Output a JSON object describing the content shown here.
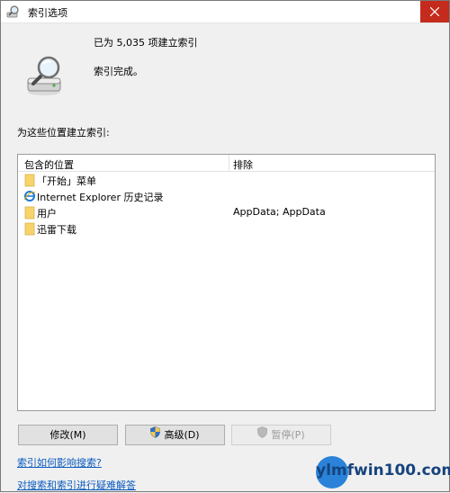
{
  "window": {
    "title": "索引选项"
  },
  "status": {
    "indexed_count": "已为 5,035 项建立索引",
    "state": "索引完成。"
  },
  "locations": {
    "heading": "为这些位置建立索引:",
    "columns": {
      "included": "包含的位置",
      "exclude": "排除"
    },
    "rows": [
      {
        "name": "「开始」菜单",
        "exclude": "",
        "icon": "folder-icon"
      },
      {
        "name": "Internet Explorer 历史记录",
        "exclude": "",
        "icon": "ie-icon"
      },
      {
        "name": "用户",
        "exclude": "AppData; AppData",
        "icon": "folder-icon"
      },
      {
        "name": "迅雷下载",
        "exclude": "",
        "icon": "folder-icon"
      }
    ]
  },
  "buttons": {
    "modify": "修改(M)",
    "advanced": "高级(D)",
    "pause": "暂停(P)"
  },
  "links": {
    "how_index_affects": "索引如何影响搜索?",
    "troubleshoot": "对搜索和索引进行疑难解答"
  },
  "watermark": {
    "text": "ylmfwin100.com"
  },
  "colors": {
    "close_button": "#c42b1c",
    "link": "#0b5bbf",
    "folder": "#f6d36b",
    "watermark": "#16437e"
  }
}
